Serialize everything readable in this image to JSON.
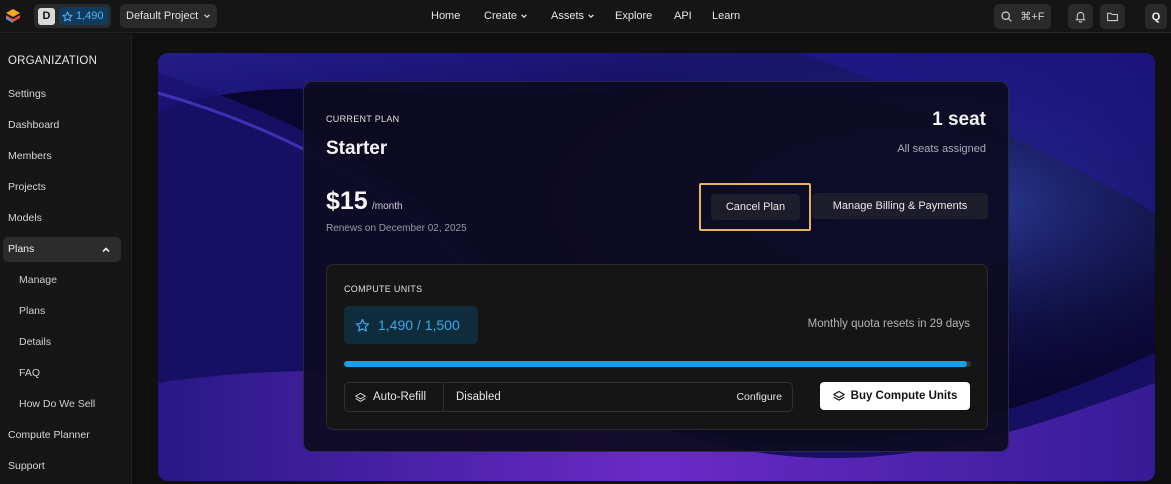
{
  "topbar": {
    "workspace_letter": "D",
    "credits": "1,490",
    "project": "Default Project",
    "nav": [
      {
        "label": "Home"
      },
      {
        "label": "Create"
      },
      {
        "label": "Assets"
      },
      {
        "label": "Explore"
      },
      {
        "label": "API"
      },
      {
        "label": "Learn"
      }
    ],
    "search_shortcut": "⌘+F",
    "avatar_letter": "Q"
  },
  "sidebar": {
    "title": "ORGANIZATION",
    "items": [
      {
        "label": "Settings"
      },
      {
        "label": "Dashboard"
      },
      {
        "label": "Members"
      },
      {
        "label": "Projects"
      },
      {
        "label": "Models"
      },
      {
        "label": "Plans"
      },
      {
        "label": "Manage"
      },
      {
        "label": "Plans"
      },
      {
        "label": "Details"
      },
      {
        "label": "FAQ"
      },
      {
        "label": "How Do We Sell"
      },
      {
        "label": "Compute Planner"
      },
      {
        "label": "Support"
      }
    ]
  },
  "plan": {
    "current_label": "CURRENT PLAN",
    "name": "Starter",
    "seats": "1 seat",
    "seats_note": "All seats assigned",
    "price": "$15",
    "period": "/month",
    "renews": "Renews on December 02, 2025",
    "cancel_label": "Cancel Plan",
    "manage_label": "Manage Billing & Payments"
  },
  "compute": {
    "label": "COMPUTE UNITS",
    "balance": "1,490 / 1,500",
    "used_fraction": 0.993,
    "reset_note": "Monthly quota resets in 29 days",
    "autorefill_label": "Auto-Refill",
    "autorefill_status": "Disabled",
    "configure_label": "Configure",
    "buy_label": "Buy Compute Units"
  },
  "colors": {
    "accent_blue": "#14a0e6",
    "highlight": "#e6b45f",
    "hero_bg": "#0b0833"
  }
}
